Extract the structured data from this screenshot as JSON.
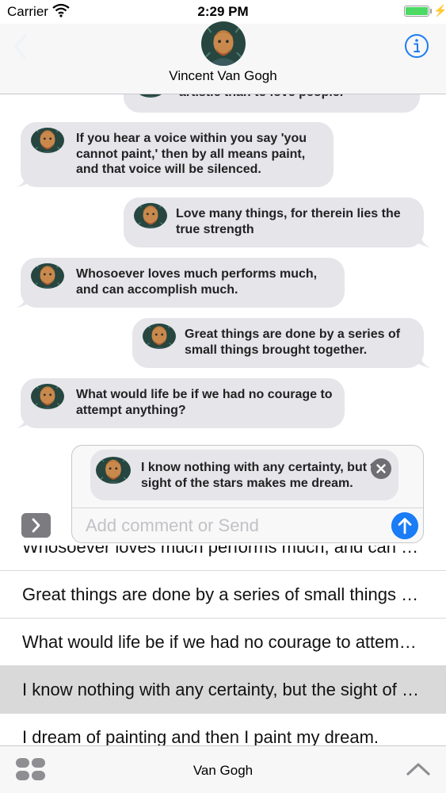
{
  "status_bar": {
    "carrier": "Carrier",
    "time": "2:29 PM"
  },
  "header": {
    "contact_name": "Vincent Van Gogh"
  },
  "messages": [
    {
      "side": "left",
      "text": "artistic than to love people."
    },
    {
      "side": "left",
      "text": "If you hear a voice within you say 'you cannot paint,' then by all means paint, and that voice will be silenced."
    },
    {
      "side": "right",
      "text": "Love many things, for therein lies the true strength"
    },
    {
      "side": "left",
      "text": "Whosoever loves much performs much, and can accomplish much."
    },
    {
      "side": "right",
      "text": "Great things are done by a series of small things brought together."
    },
    {
      "side": "left",
      "text": "What would life be if we had no courage to attempt anything?"
    }
  ],
  "comment_panel": {
    "quoted_text": "I know nothing with any certainty, but the sight of the stars makes me dream.",
    "input_placeholder": "Add comment or Send"
  },
  "quote_list": [
    {
      "text": "Whosoever loves much performs much, and can accomplish much.",
      "selected": false
    },
    {
      "text": "Great things are done by a series of small things brought together.",
      "selected": false
    },
    {
      "text": "What would life be if we had no courage to attempt anything?",
      "selected": false
    },
    {
      "text": "I know nothing with any certainty, but the sight of the stars makes me dream.",
      "selected": true
    },
    {
      "text": "I dream of painting and then I paint my dream.",
      "selected": false
    }
  ],
  "toolbar": {
    "title": "Van Gogh"
  },
  "colors": {
    "accent": "#1a7cf6",
    "bubble": "#e5e5ea",
    "battery": "#4cd964",
    "selected_row": "#d9d9d9"
  },
  "icons": [
    "wifi-icon",
    "battery-icon",
    "back-chevron-icon",
    "info-icon",
    "close-icon",
    "send-arrow-icon",
    "expand-chevron-icon",
    "grid-icon",
    "chevron-up-icon"
  ]
}
